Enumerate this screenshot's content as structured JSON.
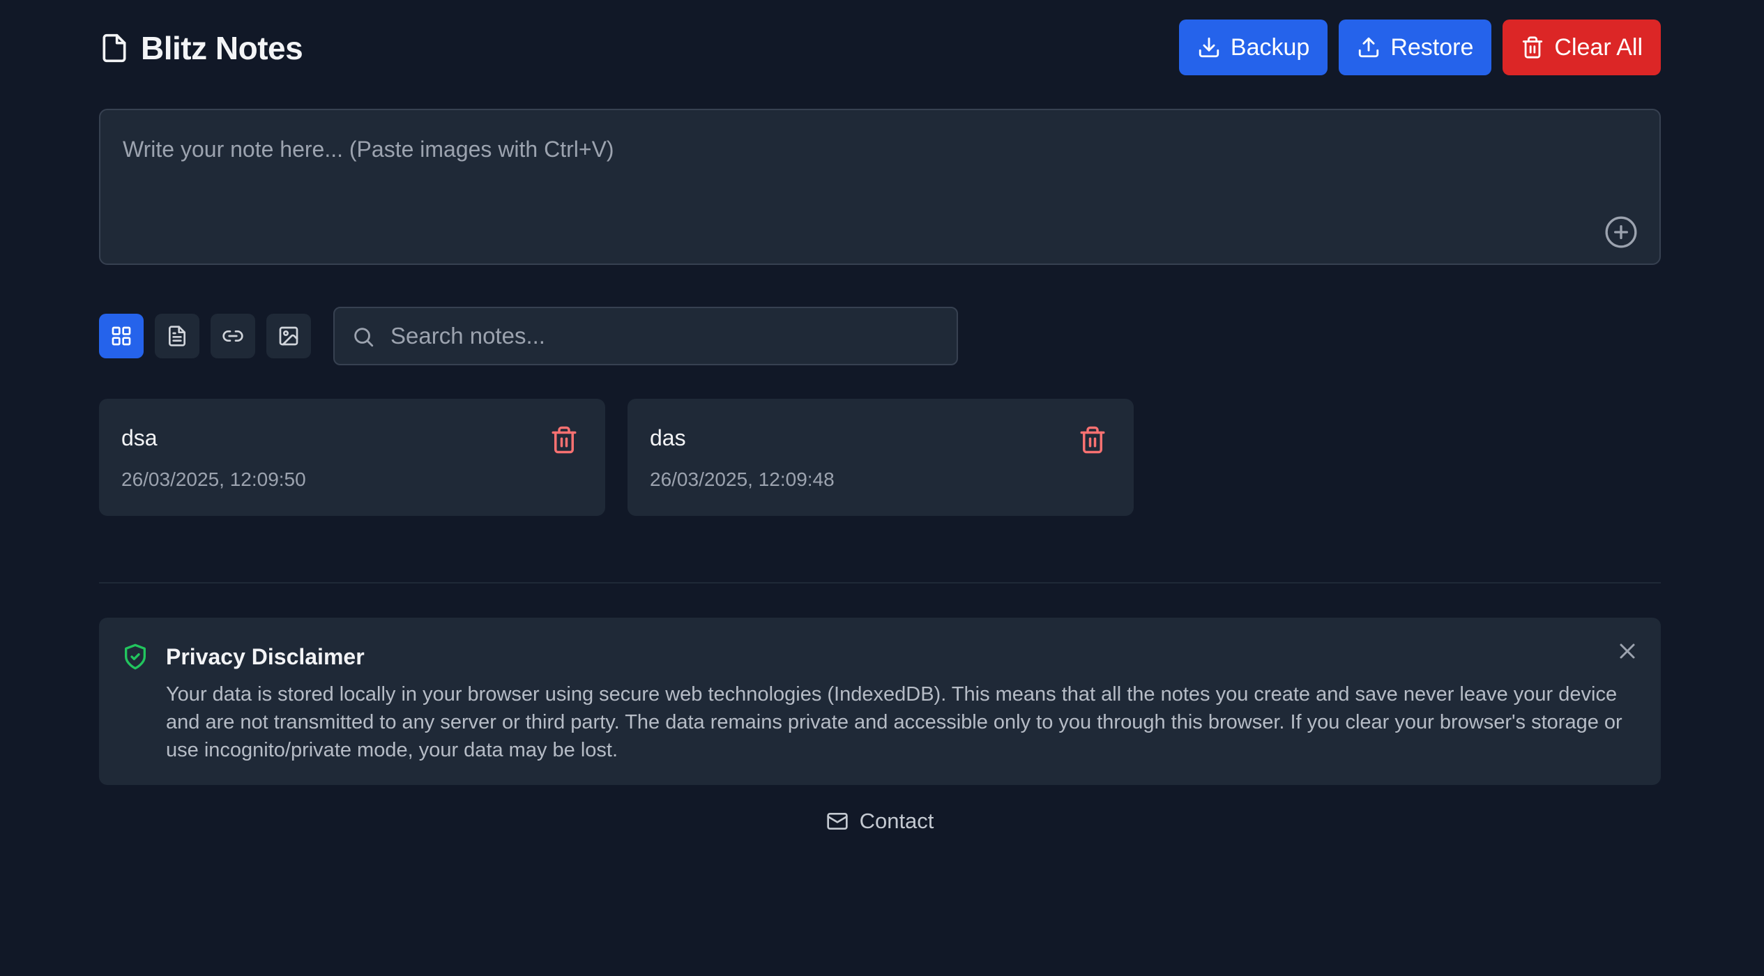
{
  "app": {
    "title": "Blitz Notes",
    "icon": "file-icon"
  },
  "header": {
    "backup_label": "Backup",
    "restore_label": "Restore",
    "clear_label": "Clear All"
  },
  "composer": {
    "placeholder": "Write your note here... (Paste images with Ctrl+V)",
    "value": ""
  },
  "filters": [
    {
      "name": "all",
      "icon": "grid-icon",
      "active": true
    },
    {
      "name": "text",
      "icon": "document-icon",
      "active": false
    },
    {
      "name": "links",
      "icon": "link-icon",
      "active": false
    },
    {
      "name": "images",
      "icon": "image-icon",
      "active": false
    }
  ],
  "search": {
    "placeholder": "Search notes...",
    "value": ""
  },
  "notes": [
    {
      "title": "dsa",
      "date": "26/03/2025, 12:09:50"
    },
    {
      "title": "das",
      "date": "26/03/2025, 12:09:48"
    }
  ],
  "disclaimer": {
    "title": "Privacy Disclaimer",
    "text": "Your data is stored locally in your browser using secure web technologies (IndexedDB). This means that all the notes you create and save never leave your device and are not transmitted to any server or third party. The data remains private and accessible only to you through this browser. If you clear your browser's storage or use incognito/private mode, your data may be lost."
  },
  "footer": {
    "contact_label": "Contact"
  },
  "colors": {
    "background": "#111827",
    "surface": "#1f2937",
    "primary": "#2563eb",
    "danger": "#dc2626",
    "delete_icon": "#f87171",
    "shield": "#22c55e"
  }
}
